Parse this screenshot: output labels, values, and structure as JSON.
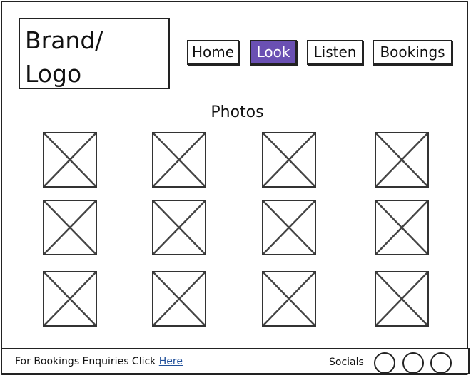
{
  "header": {
    "brand": "Brand/\nLogo",
    "nav": [
      {
        "label": "Home",
        "active": false
      },
      {
        "label": "Look",
        "active": true
      },
      {
        "label": "Listen",
        "active": false
      },
      {
        "label": "Bookings",
        "active": false
      }
    ]
  },
  "main": {
    "title": "Photos",
    "photo_rows": 3,
    "photo_cols": 4
  },
  "footer": {
    "enquiry_text": "For Bookings Enquiries Click ",
    "enquiry_link": "Here",
    "socials_label": "Socials",
    "social_icons": [
      "social-icon-1",
      "social-icon-2",
      "social-icon-3"
    ]
  },
  "colors": {
    "accent": "#6a50b3",
    "link": "#1f4f9a",
    "border": "#222222"
  }
}
